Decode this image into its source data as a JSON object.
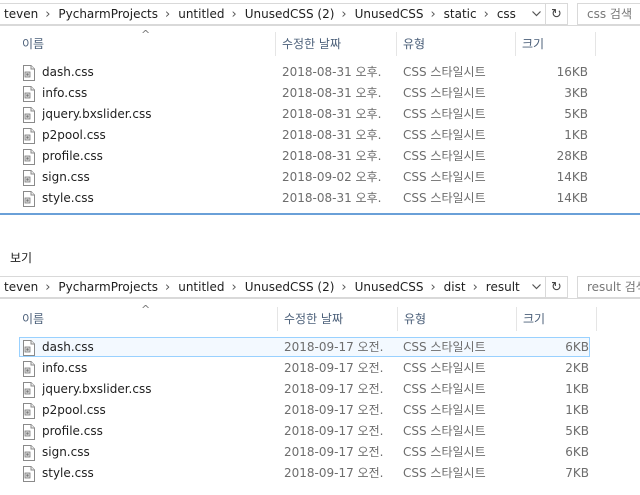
{
  "top": {
    "breadcrumbs": [
      "teven",
      "PycharmProjects",
      "untitled",
      "UnusedCSS (2)",
      "UnusedCSS",
      "static",
      "css"
    ],
    "search_placeholder": "css 검색",
    "columns": {
      "name": "이름",
      "date": "수정한 날짜",
      "type": "유형",
      "size": "크기"
    },
    "files": [
      {
        "name": "dash.css",
        "date": "2018-08-31 오후...",
        "type": "CSS 스타일시트",
        "size": "16KB"
      },
      {
        "name": "info.css",
        "date": "2018-08-31 오후...",
        "type": "CSS 스타일시트",
        "size": "3KB"
      },
      {
        "name": "jquery.bxslider.css",
        "date": "2018-08-31 오후...",
        "type": "CSS 스타일시트",
        "size": "5KB"
      },
      {
        "name": "p2pool.css",
        "date": "2018-08-31 오후...",
        "type": "CSS 스타일시트",
        "size": "1KB"
      },
      {
        "name": "profile.css",
        "date": "2018-08-31 오후...",
        "type": "CSS 스타일시트",
        "size": "28KB"
      },
      {
        "name": "sign.css",
        "date": "2018-09-02 오후...",
        "type": "CSS 스타일시트",
        "size": "14KB"
      },
      {
        "name": "style.css",
        "date": "2018-08-31 오후...",
        "type": "CSS 스타일시트",
        "size": "14KB"
      }
    ]
  },
  "menu_label": "보기",
  "bottom": {
    "breadcrumbs": [
      "teven",
      "PycharmProjects",
      "untitled",
      "UnusedCSS (2)",
      "UnusedCSS",
      "dist",
      "result"
    ],
    "search_placeholder": "result 검색",
    "columns": {
      "name": "이름",
      "date": "수정한 날짜",
      "type": "유형",
      "size": "크기"
    },
    "files": [
      {
        "name": "dash.css",
        "date": "2018-09-17 오전...",
        "type": "CSS 스타일시트",
        "size": "6KB",
        "selected": true
      },
      {
        "name": "info.css",
        "date": "2018-09-17 오전...",
        "type": "CSS 스타일시트",
        "size": "2KB"
      },
      {
        "name": "jquery.bxslider.css",
        "date": "2018-09-17 오전...",
        "type": "CSS 스타일시트",
        "size": "1KB"
      },
      {
        "name": "p2pool.css",
        "date": "2018-09-17 오전...",
        "type": "CSS 스타일시트",
        "size": "1KB"
      },
      {
        "name": "profile.css",
        "date": "2018-09-17 오전...",
        "type": "CSS 스타일시트",
        "size": "5KB"
      },
      {
        "name": "sign.css",
        "date": "2018-09-17 오전...",
        "type": "CSS 스타일시트",
        "size": "6KB"
      },
      {
        "name": "style.css",
        "date": "2018-09-17 오전...",
        "type": "CSS 스타일시트",
        "size": "7KB"
      }
    ]
  },
  "icons": {
    "dropdown": "chevron-down-icon",
    "refresh": "refresh-icon",
    "file": "css-file-icon",
    "sort": "sort-up-icon",
    "separator": "chevron-right-icon"
  }
}
